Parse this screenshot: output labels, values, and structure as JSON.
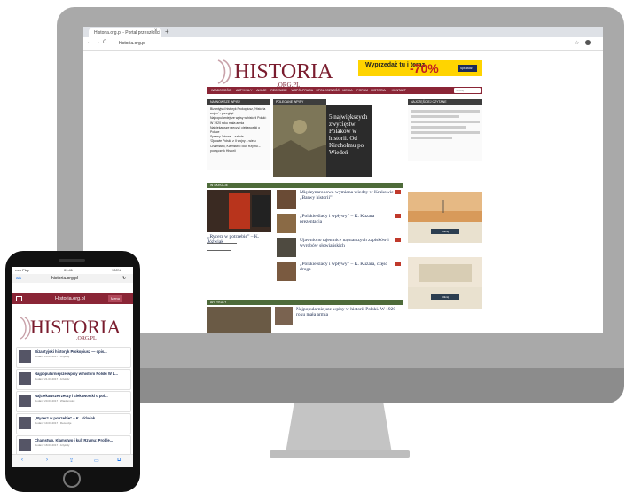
{
  "browser": {
    "tab_title": "Historia.org.pl - Portal przeszłości",
    "new_tab": "+",
    "close_tab": "×",
    "url": "historia.org.pl",
    "back": "←",
    "forward": "→",
    "reload": "C"
  },
  "site": {
    "logo_main": "HISTORIA",
    "logo_sub": ".ORG.PL",
    "ad": {
      "text": "Wyprzedaż tu i teraz",
      "percent": "-70%",
      "cta": "Sprawdź"
    },
    "menu": [
      "WIADOMOŚCI",
      "ARTYKUŁY",
      "AKCJE",
      "RECENZJE",
      "WSPÓŁPRACA",
      "SPOŁECZNOŚĆ",
      "MEDIA",
      "FORUM",
      "HISTORIA",
      "KONTAKT"
    ],
    "search_placeholder": "Szukaj",
    "left_col_head": "NAJNOWSZE WPISY",
    "left_list": [
      "Bizantyjski historyk Prokopiusz, 'Historia wojen' - przegląd",
      "Najpopularniejsze wpisy w historii Polski: W 1920 roku mała armia",
      "Najciekawsze rzeczy i ciekawostki o Polsce",
      "Sprawy Jotowe – szkoła",
      "'Ojcowie Polski' z II wojny – wielu",
      "Chamstwo, Klamstwo i kult Rzymu – podręcznik Historii"
    ],
    "featured_head": "POLECANE WPISY",
    "featured_title": "5 największych zwycięstw Polaków w historii. Od Kircholmu po Wiedeń",
    "right_col_head": "NAJCZĘŚCIEJ CZYTANE",
    "section_head": "W SKRÓCIE",
    "left_article_title": "„Rycerz w potrzebie” – K. Jóźwiak",
    "articles": [
      "Międzynarodowa wymiana wiedzy w Krakowie „Barwy historii”",
      "„Polskie ślady i wpływy” – K. Kuzara prezentacja",
      "Ujawniono tajemnice najstarszych zapisków i wyrobów słowiańskich",
      "„Polskie ślady i wpływy” – K. Kuzara, część druga"
    ],
    "section2_head": "ARTYKUŁY",
    "article_bottom": "Najpopularniejsze wpisy w historii Polski. W 1920 roku mała armia",
    "side_btn": "Kliknij"
  },
  "phone": {
    "status_left": "••••• Play",
    "status_time": "09:41",
    "status_right": "100%",
    "url": "historia.org.pl",
    "site_name": "Historia.org.pl",
    "menu_label": "Menu",
    "logo_main": "HISTORIA",
    "logo_sub": ".ORG.PL",
    "cards": [
      {
        "title": "Bizantyjski historyk Prokopiusz — opis...",
        "meta": "Dodany 24.07.2017 • Artykuły"
      },
      {
        "title": "Najpopularniejsze wpisy w historii Polski W 1...",
        "meta": "Dodany 21.07.2017 • Artykuły"
      },
      {
        "title": "Najciekawsze rzeczy i ciekawostki o pol...",
        "meta": "Dodany 20.07.2017 • Wiadomości"
      },
      {
        "title": "„Rycerz w potrzebie” – K. Jóźwiak",
        "meta": "Dodany 19.07.2017 • Recenzje"
      },
      {
        "title": "Chamstwo, Klamstwo i kult Rzymu: Proble...",
        "meta": "Dodany 18.07.2017 • Artykuły"
      }
    ]
  },
  "colors": {
    "brand": "#8a2536",
    "monitor": "#a9a9a9",
    "ad": "#ffd400"
  }
}
